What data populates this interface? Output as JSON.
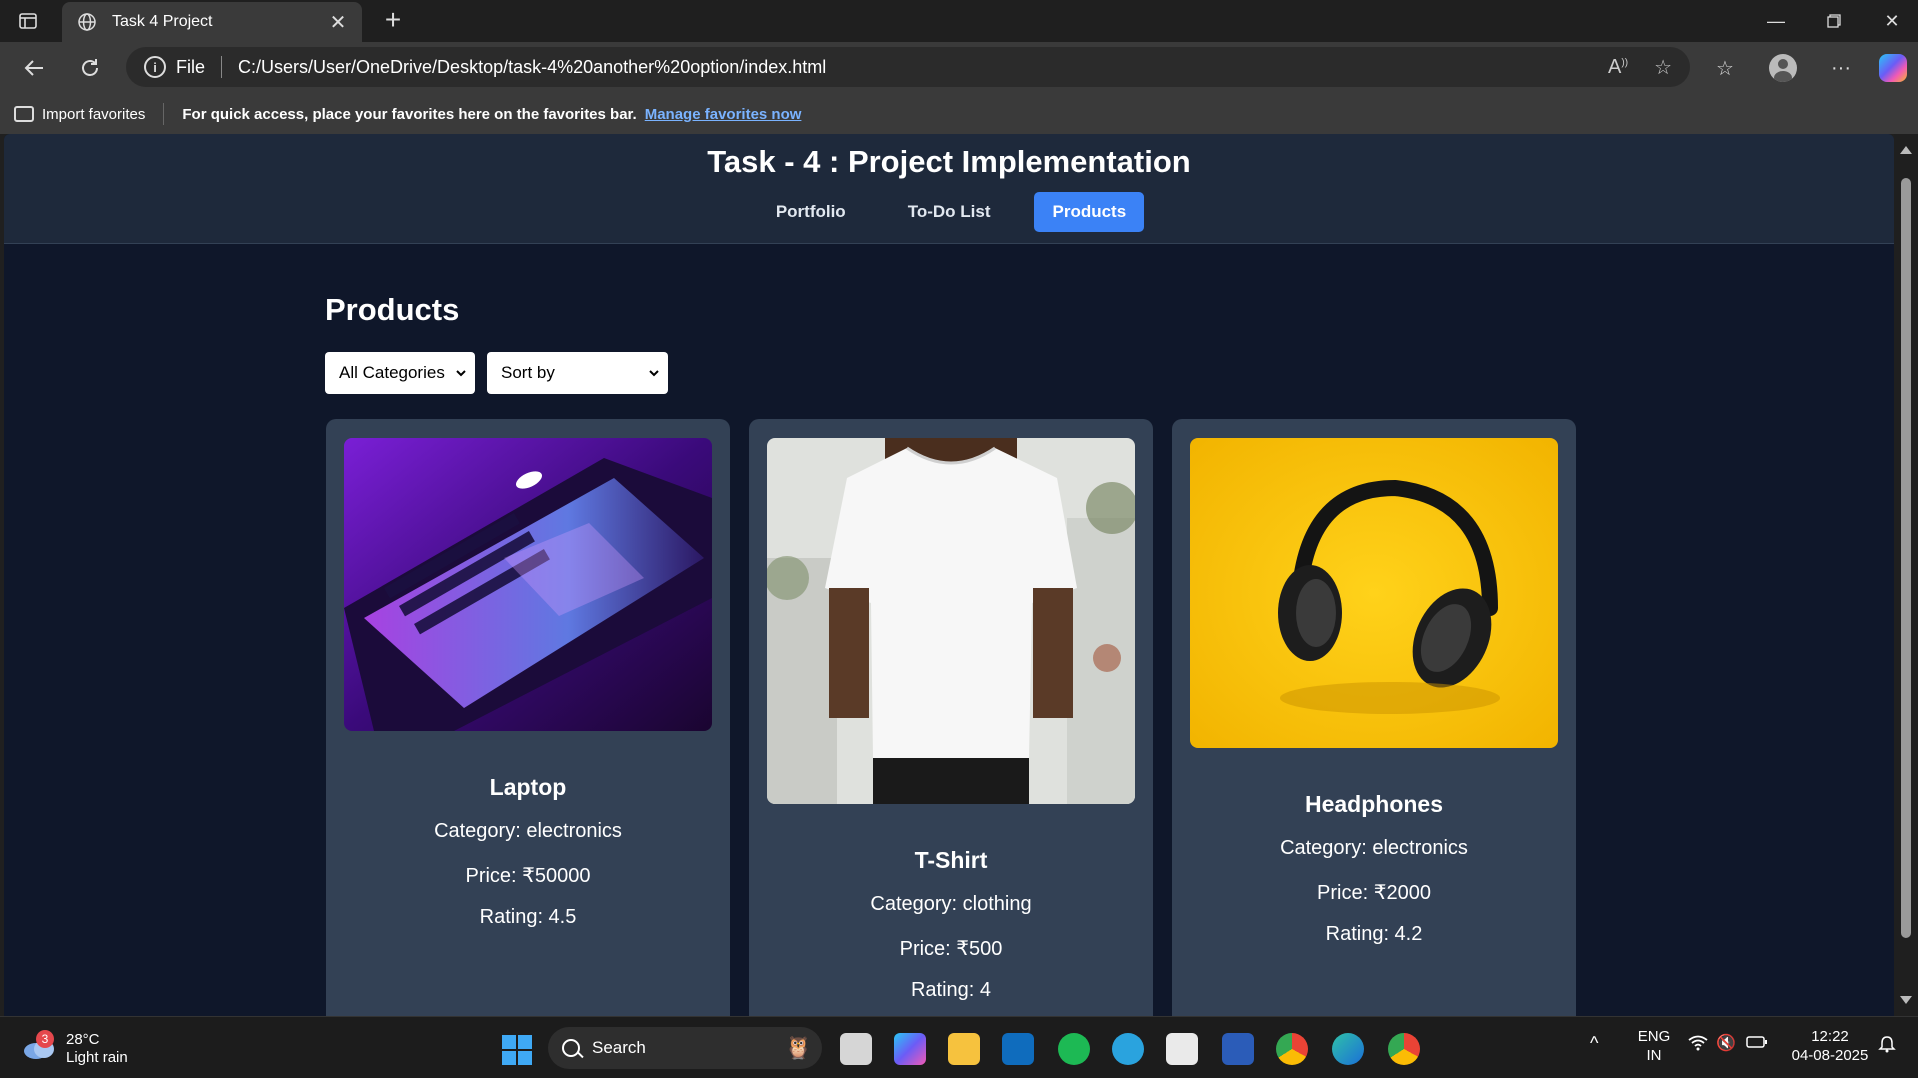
{
  "browser": {
    "tab_title": "Task 4 Project",
    "address_prefix": "File",
    "url": "C:/Users/User/OneDrive/Desktop/task-4%20another%20option/index.html",
    "favorites_bar": {
      "import_label": "Import favorites",
      "message": "For quick access, place your favorites here on the favorites bar.",
      "link_label": "Manage favorites now"
    }
  },
  "page": {
    "title": "Task - 4 : Project Implementation",
    "nav": [
      {
        "label": "Portfolio",
        "active": false
      },
      {
        "label": "To-Do List",
        "active": false
      },
      {
        "label": "Products",
        "active": true
      }
    ],
    "products_heading": "Products",
    "filters": {
      "category_selected": "All Categories",
      "sort_selected": "Sort by"
    },
    "products": [
      {
        "name": "Laptop",
        "category": "Category: electronics",
        "price": "Price: ₹50000",
        "rating": "Rating: 4.5",
        "image": "laptop-photo"
      },
      {
        "name": "T-Shirt",
        "category": "Category: clothing",
        "price": "Price: ₹500",
        "rating": "Rating: 4",
        "image": "tshirt-photo"
      },
      {
        "name": "Headphones",
        "category": "Category: electronics",
        "price": "Price: ₹2000",
        "rating": "Rating: 4.2",
        "image": "headphones-photo"
      }
    ]
  },
  "taskbar": {
    "weather_badge": "3",
    "temperature": "28°C",
    "condition": "Light rain",
    "search_label": "Search",
    "language_top": "ENG",
    "language_bottom": "IN",
    "time": "12:22",
    "date": "04-08-2025"
  },
  "colors": {
    "page_bg": "#0f172a",
    "header_bg": "#1e293b",
    "card_bg": "#334155",
    "accent": "#3b82f6"
  }
}
